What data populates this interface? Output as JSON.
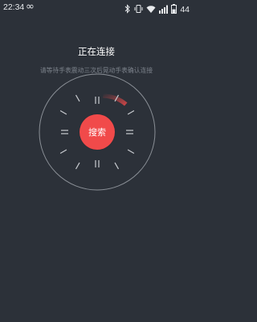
{
  "status_bar": {
    "time": "22:34",
    "battery": "44",
    "icons": [
      "infinity-icon",
      "bluetooth-icon",
      "vibrate-icon",
      "wifi-icon",
      "signal-icon",
      "battery-icon"
    ]
  },
  "connection": {
    "title": "正在连接",
    "hint": "请等待手表震动三次后晃动手表确认连接"
  },
  "search_button": {
    "label": "搜索"
  },
  "colors": {
    "background": "#2c3139",
    "accent": "#f14a4a",
    "muted_text": "#7c828b",
    "dial_line": "#8b9097"
  }
}
